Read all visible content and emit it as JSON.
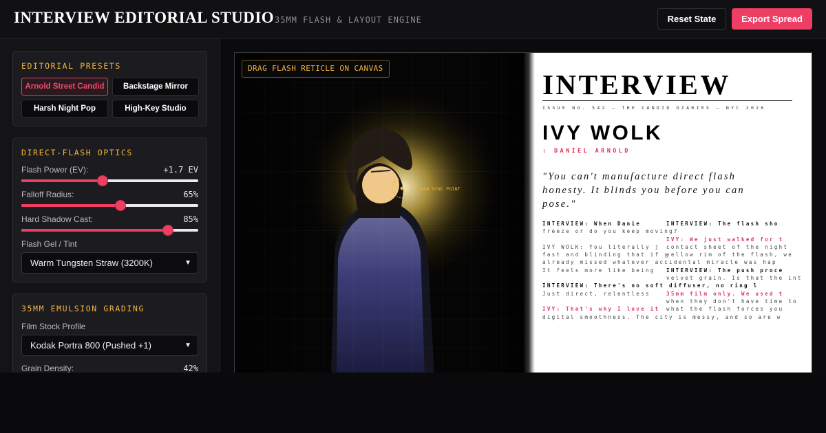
{
  "header": {
    "title": "INTERVIEW EDITORIAL STUDIO",
    "subtitle": "35MM FLASH & LAYOUT ENGINE",
    "reset_label": "Reset State",
    "export_label": "Export Spread"
  },
  "presets": {
    "title": "EDITORIAL PRESETS",
    "items": [
      "Arnold Street Candid",
      "Backstage Mirror",
      "Harsh Night Pop",
      "High-Key Studio"
    ],
    "active": "Arnold Street Candid"
  },
  "optics": {
    "title": "DIRECT-FLASH OPTICS",
    "flash_power": {
      "label": "Flash Power (EV):",
      "value": "+1.7 EV",
      "fraction": 0.46
    },
    "falloff": {
      "label": "Falloff Radius:",
      "value": "65%",
      "fraction": 0.56
    },
    "shadow": {
      "label": "Hard Shadow Cast:",
      "value": "85%",
      "fraction": 0.83
    },
    "gel": {
      "label": "Flash Gel / Tint",
      "value": "Warm Tungsten Straw (3200K)"
    }
  },
  "emulsion": {
    "title": "35MM EMULSION GRADING",
    "stock": {
      "label": "Film Stock Profile",
      "value": "Kodak Portra 800 (Pushed +1)"
    },
    "grain": {
      "label": "Grain Density:",
      "value": "42%"
    }
  },
  "canvas": {
    "drag_hint": "DRAG FLASH RETICLE ON CANVAS",
    "reticle_label": "FLASH SYNC POINT"
  },
  "magazine": {
    "title": "INTERVIEW",
    "issue": "ISSUE NO. 542 — THE CANDID DIARIES — NYC 2026",
    "name": "IVY WOLK",
    "credit": ": DANIEL ARNOLD",
    "quote": "\"You can't manufacture direct flash honesty. It blinds you before you can pose.\"",
    "col1": [
      {
        "kind": "q",
        "text": "INTERVIEW: When Danie"
      },
      {
        "kind": "a",
        "text": "freeze or do you keep moving?"
      },
      {
        "kind": "blank",
        "text": ""
      },
      {
        "kind": "a",
        "text": "IVY WOLK: You literally j"
      },
      {
        "kind": "a",
        "text": "fast and blinding that if y"
      },
      {
        "kind": "a",
        "text": "already missed whatever accidental miracle was hap"
      },
      {
        "kind": "a",
        "text": "It feels more like being"
      },
      {
        "kind": "blank",
        "text": ""
      },
      {
        "kind": "q",
        "text": "INTERVIEW: There's no soft diffuser, no ring l"
      },
      {
        "kind": "a",
        "text": "Just direct, relentless"
      },
      {
        "kind": "blank",
        "text": ""
      },
      {
        "kind": "ivy",
        "text": "IVY: That's why I love it"
      },
      {
        "kind": "a",
        "text": "digital smoothness. The city is messy, and so are w"
      }
    ],
    "col2": [
      {
        "kind": "q",
        "text": "INTERVIEW: The flash sho"
      },
      {
        "kind": "blank",
        "text": ""
      },
      {
        "kind": "ivy",
        "text": "IVY: We just walked for t"
      },
      {
        "kind": "a",
        "text": "contact sheet of the night"
      },
      {
        "kind": "a",
        "text": "yellow rim of the flash, we"
      },
      {
        "kind": "blank",
        "text": ""
      },
      {
        "kind": "q",
        "text": "INTERVIEW: The push proce"
      },
      {
        "kind": "a",
        "text": "velvet grain. Is that the int"
      },
      {
        "kind": "blank",
        "text": ""
      },
      {
        "kind": "ivy",
        "text": "35mm film only. We used t"
      },
      {
        "kind": "a",
        "text": "when they don't have time to"
      },
      {
        "kind": "a",
        "text": "what the flash forces you"
      }
    ]
  }
}
